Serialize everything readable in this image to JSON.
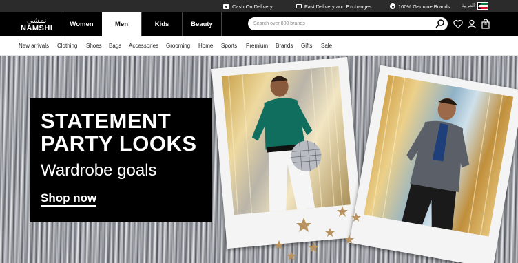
{
  "topbar": {
    "cod": "Cash On Delivery",
    "delivery": "Fast Delivery and Exchanges",
    "genuine": "100% Genuine Brands",
    "language": "العربية",
    "icons": {
      "cod": "cash-icon",
      "delivery": "delivery-icon",
      "genuine": "genuine-badge-icon",
      "flag": "kuwait-flag-icon"
    }
  },
  "header": {
    "logo_ar": "نمشي",
    "logo_en": "NAMSHI",
    "departments": [
      {
        "label": "Women",
        "active": false
      },
      {
        "label": "Men",
        "active": true
      },
      {
        "label": "Kids",
        "active": false
      },
      {
        "label": "Beauty",
        "active": false
      }
    ],
    "search_placeholder": "Search over 800 brands",
    "cart_count": "0",
    "icons": [
      "search-icon",
      "heart-icon",
      "user-icon",
      "cart-icon"
    ]
  },
  "categories": [
    "New arrivals",
    "Clothing",
    "Shoes",
    "Bags",
    "Accessories",
    "Grooming",
    "Home",
    "Sports",
    "Premium",
    "Brands",
    "Gifts",
    "Sale"
  ],
  "hero": {
    "title_line1": "STATEMENT",
    "title_line2": "PARTY LOOKS",
    "subtitle": "Wardrobe goals",
    "cta": "Shop now"
  },
  "colors": {
    "topbar": "#2b2b2b",
    "header": "#000000",
    "active_tab": "#ffffff",
    "hero_box": "#000000"
  }
}
